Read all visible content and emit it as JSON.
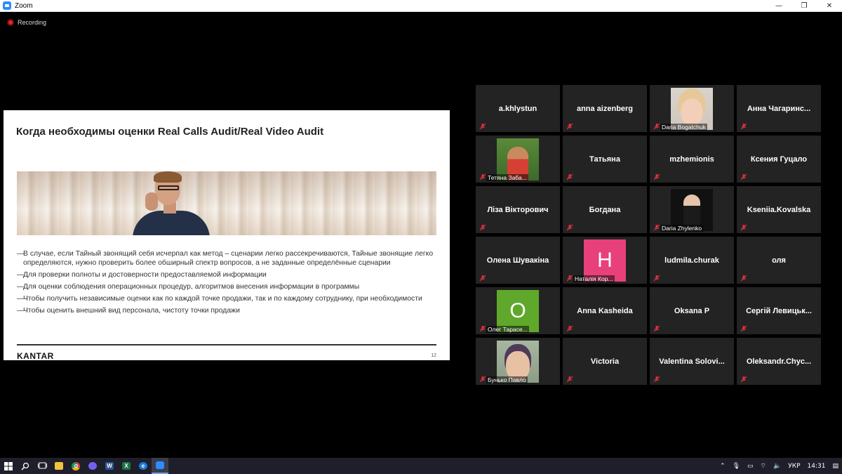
{
  "window": {
    "title": "Zoom",
    "controls": {
      "minimize": "—",
      "restore": "❐",
      "close": "✕"
    }
  },
  "recording": {
    "label": "Recording"
  },
  "slide": {
    "title": "Когда необходимы оценки Real Calls Audit/Real Video Audit",
    "bullets": [
      "В случае, если Тайный звонящий себя исчерпал как метод – сценарии легко рассекречиваются, Тайные звонящие легко определяются, нужно проверить более обширный спектр вопросов, а не заданные определённые сценарии",
      "Для проверки полноты и достоверности предоставляемой информации",
      "Для оценки соблюдения операционных процедур, алгоритмов внесения информации в программы",
      "Чтобы получить независимые оценки как по каждой точке продажи, так и по каждому сотруднику, при необходимости",
      "Чтобы оценить внешний вид персонала, чистоту точки продажи"
    ],
    "bullet_marker": "—",
    "logo": "KANTAR",
    "page_number": "12"
  },
  "participants": [
    {
      "name": "a.khlystun",
      "display": "name"
    },
    {
      "name": "anna aizenberg",
      "display": "name"
    },
    {
      "name": "Daria Bogatchuk",
      "display": "photo",
      "photo": "photo-a"
    },
    {
      "name": "Анна Чагаринс...",
      "display": "name"
    },
    {
      "name": "Тетяна Заба...",
      "display": "photo",
      "photo": "photo-b"
    },
    {
      "name": "Татьяна",
      "display": "name"
    },
    {
      "name": "mzhemionis",
      "display": "name"
    },
    {
      "name": "Ксения Гуцало",
      "display": "name"
    },
    {
      "name": "Ліза Вікторович",
      "display": "name"
    },
    {
      "name": "Богдана",
      "display": "name"
    },
    {
      "name": "Daria Zhylenko",
      "display": "photo",
      "photo": "photo-c"
    },
    {
      "name": "Kseniia.Kovalska",
      "display": "name"
    },
    {
      "name": "Олена Шувакіна",
      "display": "name"
    },
    {
      "name": "Наталія Кор...",
      "display": "letter",
      "letter": "H",
      "color": "#e8407a"
    },
    {
      "name": "ludmila.churak",
      "display": "name"
    },
    {
      "name": "оля",
      "display": "name"
    },
    {
      "name": "Олег Тарасе...",
      "display": "letter",
      "letter": "O",
      "color": "#5fa82c"
    },
    {
      "name": "Anna Kasheida",
      "display": "name"
    },
    {
      "name": "Oksana P",
      "display": "name"
    },
    {
      "name": "Сергій Левицьк...",
      "display": "name"
    },
    {
      "name": "Бунько Павло",
      "display": "photo",
      "photo": "photo-d"
    },
    {
      "name": "Victoria",
      "display": "name"
    },
    {
      "name": "Valentina Solovi...",
      "display": "name"
    },
    {
      "name": "Oleksandr.Chyc...",
      "display": "name"
    }
  ],
  "taskbar": {
    "apps": [
      "start",
      "search",
      "task-view",
      "file-explorer",
      "chrome",
      "viber",
      "word",
      "excel",
      "edge",
      "zoom"
    ],
    "language": "УКР",
    "time": "14:31"
  },
  "colors": {
    "mic_muted": "#e0323a",
    "tile_bg": "#232323"
  }
}
